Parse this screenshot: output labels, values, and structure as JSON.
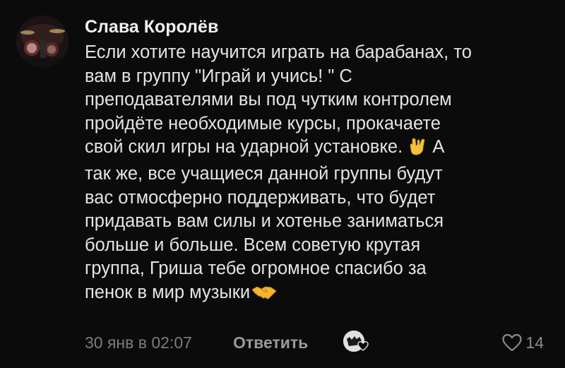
{
  "comment": {
    "author": "Слава Королёв",
    "lines": [
      "Если хотите научится играть на барабанах, то",
      "вам в группу \"Играй и учись! \" С",
      "преподавателями вы под чутким контролем",
      "пройдёте необходимые курсы, прокачаете",
      {
        "before": "свой скил игры на ударной установке. ",
        "emoji": "🤘",
        "after": " А"
      },
      "так же, все учащиеся данной группы будут",
      "вас отмосферно поддерживать, что будет",
      "придавать вам силы и хотенье заниматься",
      "больше и больше. Всем советую крутая",
      "группа, Гриша тебе огромное  спасибо за",
      {
        "before": "пенок в мир музыки",
        "emoji": "🤝",
        "after": ""
      }
    ],
    "timestamp": "30 янв в 02:07",
    "reply_label": "Ответить",
    "like_count": "14"
  },
  "icons": {
    "avatar": "drum-kit-photo",
    "author_like": "author-liked-heart-icon",
    "like": "heart-outline-icon",
    "emoji_rock": "rock-on-hand-emoji",
    "emoji_handshake": "handshake-emoji"
  },
  "colors": {
    "background": "#0b0b0b",
    "text": "#e4e4e4",
    "muted": "#7c7c7c",
    "accent_heart": "#f5566a"
  }
}
